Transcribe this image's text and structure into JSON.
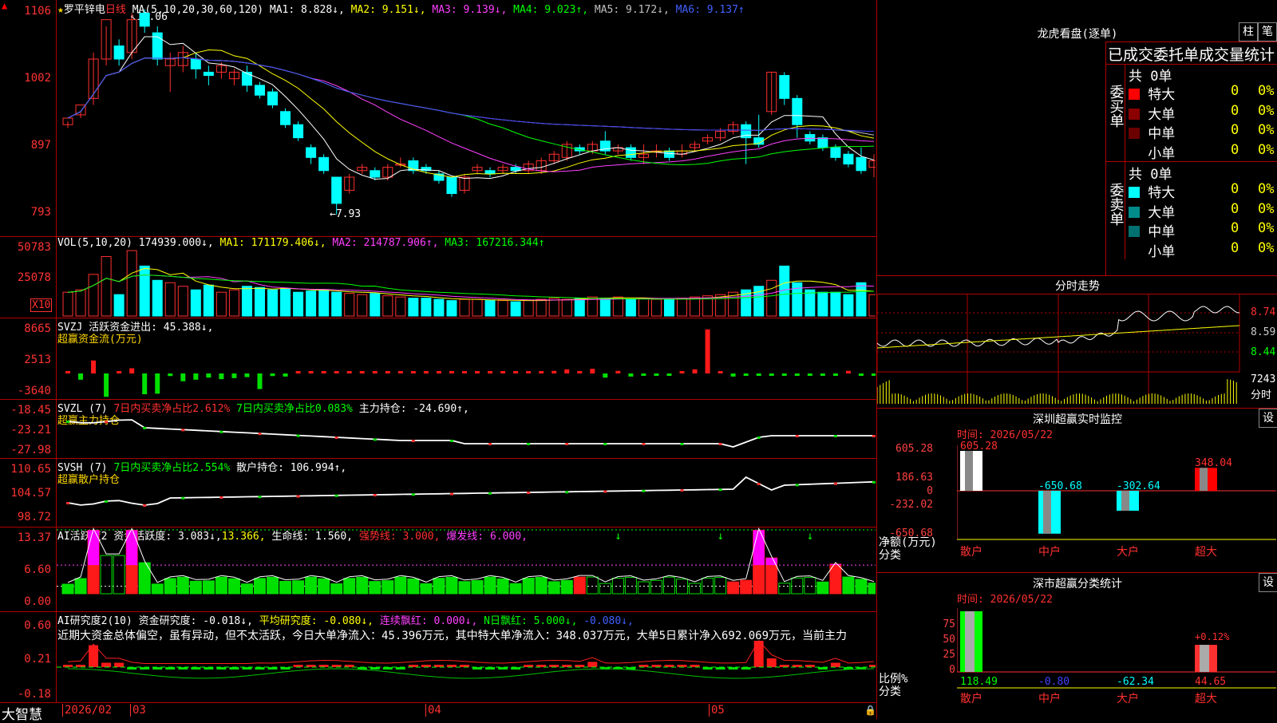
{
  "chart": {
    "stock_name": "罗平锌电",
    "period": "日线",
    "ma_params": "MA(5,10,20,30,60,120)",
    "ma": [
      {
        "label": "MA1: 8.828↓,",
        "color": "#ffffff"
      },
      {
        "label": "MA2: 9.151↓,",
        "color": "#ffff00"
      },
      {
        "label": "MA3: 9.139↓,",
        "color": "#ff40ff"
      },
      {
        "label": "MA4: 9.023↑,",
        "color": "#00ff00"
      },
      {
        "label": "MA5: 9.172↓,",
        "color": "#c0c0c0"
      },
      {
        "label": "MA6: 9.137↑",
        "color": "#4040ff"
      }
    ],
    "high_label": "11.06",
    "low_label": "←7.93",
    "price_axis": [
      "1106",
      "1002",
      "897",
      "793"
    ],
    "price_range": [
      7.6,
      11.2
    ],
    "candles": [
      [
        9.3,
        9.4,
        9.25,
        9.35
      ],
      [
        9.45,
        9.6,
        9.4,
        9.5
      ],
      [
        9.7,
        10.3,
        9.6,
        10.4
      ],
      [
        10.3,
        10.9,
        10.2,
        10.8
      ],
      [
        10.5,
        10.3,
        10.2,
        10.6
      ],
      [
        10.4,
        10.9,
        10.3,
        11.0
      ],
      [
        11.0,
        10.8,
        10.7,
        11.06
      ],
      [
        10.7,
        10.3,
        10.2,
        10.8
      ],
      [
        10.2,
        10.3,
        9.8,
        10.4
      ],
      [
        10.2,
        10.4,
        10.1,
        10.5
      ],
      [
        10.3,
        10.15,
        10.0,
        10.4
      ],
      [
        10.1,
        10.05,
        9.9,
        10.2
      ],
      [
        10.1,
        10.2,
        10.0,
        10.25
      ],
      [
        10.0,
        10.1,
        9.9,
        10.15
      ],
      [
        10.1,
        9.9,
        9.8,
        10.2
      ],
      [
        9.9,
        9.75,
        9.7,
        9.95
      ],
      [
        9.8,
        9.6,
        9.55,
        9.85
      ],
      [
        9.5,
        9.3,
        9.25,
        9.55
      ],
      [
        9.3,
        9.1,
        9.05,
        9.35
      ],
      [
        8.95,
        8.8,
        8.7,
        9.0
      ],
      [
        8.8,
        8.6,
        8.55,
        8.85
      ],
      [
        8.5,
        8.1,
        7.93,
        8.5
      ],
      [
        8.3,
        8.5,
        8.25,
        8.55
      ],
      [
        8.6,
        8.65,
        8.55,
        8.7
      ],
      [
        8.6,
        8.5,
        8.45,
        8.65
      ],
      [
        8.5,
        8.65,
        8.45,
        8.7
      ],
      [
        8.7,
        8.7,
        8.65,
        8.8
      ],
      [
        8.75,
        8.6,
        8.55,
        8.8
      ],
      [
        8.65,
        8.6,
        8.55,
        8.7
      ],
      [
        8.55,
        8.45,
        8.4,
        8.6
      ],
      [
        8.5,
        8.25,
        8.2,
        8.5
      ],
      [
        8.3,
        8.5,
        8.25,
        8.55
      ],
      [
        8.6,
        8.65,
        8.55,
        8.7
      ],
      [
        8.6,
        8.55,
        8.5,
        8.65
      ],
      [
        8.6,
        8.65,
        8.55,
        8.7
      ],
      [
        8.65,
        8.6,
        8.55,
        8.7
      ],
      [
        8.6,
        8.7,
        8.55,
        8.75
      ],
      [
        8.6,
        8.75,
        8.55,
        8.8
      ],
      [
        8.75,
        8.85,
        8.7,
        8.9
      ],
      [
        8.8,
        9.0,
        8.75,
        9.05
      ],
      [
        8.95,
        8.9,
        8.85,
        9.0
      ],
      [
        8.9,
        9.0,
        8.85,
        9.05
      ],
      [
        9.05,
        8.9,
        8.85,
        9.2
      ],
      [
        8.9,
        8.95,
        8.85,
        9.0
      ],
      [
        8.95,
        8.8,
        8.75,
        9.0
      ],
      [
        8.8,
        8.85,
        8.7,
        9.0
      ],
      [
        8.9,
        8.9,
        8.8,
        9.0
      ],
      [
        8.9,
        8.8,
        8.75,
        8.95
      ],
      [
        8.85,
        8.9,
        8.8,
        9.0
      ],
      [
        8.95,
        9.0,
        8.9,
        9.05
      ],
      [
        9.05,
        9.1,
        9.0,
        9.15
      ],
      [
        9.1,
        9.2,
        9.05,
        9.25
      ],
      [
        9.2,
        9.3,
        9.15,
        9.35
      ],
      [
        9.3,
        9.1,
        8.7,
        9.35
      ],
      [
        9.1,
        9.0,
        8.95,
        9.45
      ],
      [
        9.5,
        10.1,
        9.45,
        10.1
      ],
      [
        10.05,
        9.7,
        9.6,
        10.1
      ],
      [
        9.7,
        9.3,
        9.1,
        9.75
      ],
      [
        9.15,
        9.05,
        9.0,
        9.2
      ],
      [
        9.1,
        8.95,
        8.9,
        9.15
      ],
      [
        8.95,
        8.8,
        8.75,
        9.0
      ],
      [
        8.85,
        8.7,
        8.65,
        8.9
      ],
      [
        8.8,
        8.6,
        8.55,
        8.95
      ],
      [
        8.65,
        8.75,
        8.5,
        8.85
      ]
    ]
  },
  "volume": {
    "header_prefix": "VOL(5,10,20)",
    "total": "174939.000↓,",
    "ma1": "MA1: 171179.406↓,",
    "ma2": "MA2: 214787.906↑,",
    "ma3": "MA3: 167216.344↑",
    "axis": [
      "50783",
      "25078"
    ],
    "unit": "X10",
    "values": [
      20,
      22,
      35,
      50,
      18,
      55,
      42,
      30,
      28,
      25,
      22,
      26,
      20,
      22,
      25,
      24,
      22,
      23,
      20,
      21,
      22,
      20,
      19,
      18,
      19,
      17,
      16,
      15,
      15,
      14,
      13,
      14,
      14,
      13,
      13,
      12,
      13,
      14,
      15,
      14,
      15,
      16,
      15,
      16,
      14,
      15,
      14,
      14,
      15,
      16,
      17,
      18,
      20,
      22,
      25,
      30,
      42,
      28,
      22,
      20,
      20,
      18,
      28,
      18
    ]
  },
  "svzj": {
    "name": "SVZJ",
    "label": "活跃资金进出: 45.388↓,",
    "subtitle": "超赢资金流(万元)",
    "axis": [
      "8665",
      "2513",
      "-3640"
    ],
    "values": [
      0.3,
      -1.2,
      2.5,
      -4.5,
      0.4,
      1.0,
      -4.0,
      -3.9,
      -0.5,
      -1.5,
      -1.2,
      -0.8,
      -1.1,
      -0.9,
      -0.7,
      -3.0,
      -0.5,
      -0.6,
      0.2,
      0.1,
      0.2,
      0.1,
      0.2,
      0.1,
      0.1,
      0.1,
      0.1,
      0.2,
      0.1,
      0.1,
      0.1,
      0.1,
      0.1,
      0.1,
      0.1,
      0.1,
      0.1,
      0.3,
      0.5,
      0.8,
      0.4,
      0.9,
      -0.8,
      0.5,
      -0.6,
      -0.4,
      -0.3,
      -0.4,
      0.3,
      0.8,
      8.5,
      0.4,
      -0.6,
      -0.3,
      -0.3,
      -0.2,
      -0.3,
      -0.2,
      -0.2,
      -0.3,
      -0.2,
      0.5,
      -0.2,
      -0.3
    ]
  },
  "svzl": {
    "name": "SVZL (7)",
    "label1": "7日内买卖净占比2.612%",
    "label2": "7日内买卖净占比0.083%",
    "label3": "主力持仓: -24.690↑,",
    "subtitle": "超赢主力持仓",
    "axis": [
      "-18.45",
      "-23.21",
      "-27.98"
    ]
  },
  "svsh": {
    "name": "SVSH (7)",
    "label1": "7日内买卖净占比2.554%",
    "label2": "散户持仓: 106.994↑,",
    "subtitle": "超赢散户持仓",
    "axis": [
      "110.65",
      "104.57",
      "98.72"
    ]
  },
  "ai1": {
    "name": "AI活跃度2",
    "label1": "资金活跃度: 3.083↓,",
    "label2": "13.366,",
    "label3": "生命线: 1.560,",
    "label4": "强势线: 3.000,",
    "label5": "爆发线: 6.000,",
    "axis": [
      "13.37",
      "6.60",
      "0.00"
    ]
  },
  "ai2": {
    "name": "AI研究度2(10)",
    "label1": "资金研究度: -0.018↓,",
    "label2": "平均研究度: -0.080↓,",
    "label3": "连续飘红: 0.000↓,",
    "label4": "N日飘红: 5.000↓,",
    "label5": "-0.080↓,",
    "text": "近期大资金总体偏空，虽有异动，但不太活跃，今日大单净流入：45.396万元，其中特大单净流入：348.037万元，大单5日累计净入692.069万元，当前主力",
    "axis": [
      "0.60",
      "0.21",
      "-0.18"
    ]
  },
  "timeline": {
    "logo": "大智慧",
    "labels": [
      "2026/02",
      "03",
      "04",
      "05"
    ]
  },
  "longhu": {
    "title": "龙虎看盘(逐单)",
    "btn1": "柱",
    "btn2": "笔",
    "header": "已成交委托单成交量统计",
    "buy_title": "委买单",
    "sell_title": "委卖单",
    "buy_total": "共 0单",
    "sell_total": "共 0单",
    "buy_rows": [
      {
        "label": "特大",
        "count": "0",
        "pct": "0%",
        "color": "#ff0000"
      },
      {
        "label": "大单",
        "count": "0",
        "pct": "0%",
        "color": "#8b0000"
      },
      {
        "label": "中单",
        "count": "0",
        "pct": "0%",
        "color": "#6a0000"
      },
      {
        "label": "小单",
        "count": "0",
        "pct": "0%",
        "color": ""
      }
    ],
    "sell_rows": [
      {
        "label": "特大",
        "count": "0",
        "pct": "0%",
        "color": "#00ffff"
      },
      {
        "label": "大单",
        "count": "0",
        "pct": "0%",
        "color": "#008b8b"
      },
      {
        "label": "中单",
        "count": "0",
        "pct": "0%",
        "color": "#007070"
      },
      {
        "label": "小单",
        "count": "0",
        "pct": "0%",
        "color": ""
      }
    ]
  },
  "fenshi": {
    "title": "分时走势",
    "axis": [
      "8.74",
      "8.59",
      "8.44"
    ],
    "vol": "7243",
    "vol_label": "分时"
  },
  "monitor": {
    "title": "深圳超赢实时监控",
    "btn": "设",
    "time": "时间: 2026/05/22",
    "axis": [
      "605.28",
      "186.63",
      "0",
      "-232.02",
      "-650.68"
    ],
    "ylabel1": "净额(万元)",
    "ylabel2": "分类",
    "bars": [
      {
        "cat": "散户",
        "value": 605.28,
        "label": "605.28",
        "color": "#ffffff"
      },
      {
        "cat": "中户",
        "value": -650.68,
        "label": "-650.68",
        "color": "#00ffff"
      },
      {
        "cat": "大户",
        "value": -302.64,
        "label": "-302.64",
        "color": "#00ffff"
      },
      {
        "cat": "超大",
        "value": 348.04,
        "label": "348.04",
        "color": "#ff0000"
      }
    ]
  },
  "stats": {
    "title": "深市超赢分类统计",
    "btn": "设",
    "time": "时间: 2026/05/22",
    "axis": [
      "75",
      "50",
      "25",
      "0"
    ],
    "ylabel1": "比例%",
    "ylabel2": "分类",
    "top_label": "+0.12%",
    "bars": [
      {
        "cat": "散户",
        "value": 118.49,
        "label": "118.49",
        "color": "#00ff00"
      },
      {
        "cat": "中户",
        "value": -0.8,
        "label": "-0.80",
        "color": "#4040ff"
      },
      {
        "cat": "大户",
        "value": -62.34,
        "label": "-62.34",
        "color": "#00ffff"
      },
      {
        "cat": "超大",
        "value": 44.65,
        "label": "44.65",
        "color": "#ff3030"
      }
    ]
  }
}
